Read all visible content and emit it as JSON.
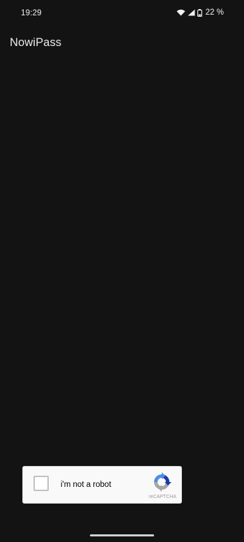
{
  "status_bar": {
    "time": "19:29",
    "battery": "22 %",
    "icons": [
      "wifi-icon",
      "signal-icon",
      "battery-icon"
    ]
  },
  "app_bar": {
    "title": "NowiPass"
  },
  "captcha": {
    "label": "i'm not a robot",
    "brand": "reCAPTCHA",
    "checked": false,
    "icon": "recaptcha-logo-icon"
  },
  "colors": {
    "background": "#131313",
    "text": "#e9e9e9",
    "captcha_bg": "#f9f9f9",
    "captcha_blue": "#4a90e2",
    "captcha_gray": "#a6a6a6"
  }
}
